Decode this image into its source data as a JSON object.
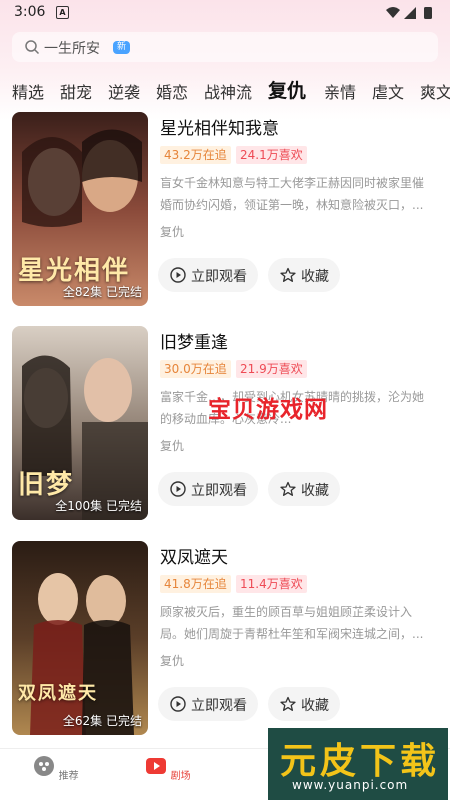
{
  "status": {
    "time": "3:06",
    "a_glyph": "A"
  },
  "search": {
    "text": "一生所安",
    "badge": "新"
  },
  "tabs": [
    {
      "label": "精选"
    },
    {
      "label": "甜宠"
    },
    {
      "label": "逆袭"
    },
    {
      "label": "婚恋"
    },
    {
      "label": "战神流"
    },
    {
      "label": "复仇",
      "active": true
    },
    {
      "label": "亲情"
    },
    {
      "label": "虐文"
    },
    {
      "label": "爽文"
    }
  ],
  "dramas": [
    {
      "title": "星光相伴知我意",
      "follow": "43.2万在追",
      "like": "24.1万喜欢",
      "desc": "盲女千金林知意与特工大佬李正赫因同时被家里催婚而协约闪婚，领证第一晚，林知意险被灭口，...",
      "genre": "复仇",
      "poster_title": "星光相伴",
      "episodes": "全82集",
      "status": "已完结",
      "colors": [
        "#3a1f1a",
        "#8a4a3a",
        "#c98a6a"
      ]
    },
    {
      "title": "旧梦重逢",
      "follow": "30.0万在追",
      "like": "21.9万喜欢",
      "desc": "富家千金…，却受到心机女苏晴晴的挑拨，沦为她的移动血库。心灰意冷...",
      "genre": "复仇",
      "poster_title": "旧梦",
      "episodes": "全100集",
      "status": "已完结",
      "colors": [
        "#d9cfc4",
        "#8f7f72",
        "#3b2f2a"
      ]
    },
    {
      "title": "双凤遮天",
      "follow": "41.8万在追",
      "like": "11.4万喜欢",
      "desc": "顾家被灭后，重生的顾百草与姐姐顾芷柔设计入局。她们周旋于青帮杜年笙和军阀宋连城之间，...",
      "genre": "复仇",
      "poster_title": "双凤遮天",
      "episodes": "全62集",
      "status": "已完结",
      "colors": [
        "#2a1c14",
        "#5a3e28",
        "#b08850"
      ]
    }
  ],
  "buttons": {
    "watch": "立即观看",
    "fav": "收藏"
  },
  "watermark": "宝贝游戏网",
  "nav": {
    "recommend": "推荐",
    "theater": "剧场"
  },
  "logo": {
    "text": "元皮下载",
    "url": "www.yuanpi.com"
  }
}
